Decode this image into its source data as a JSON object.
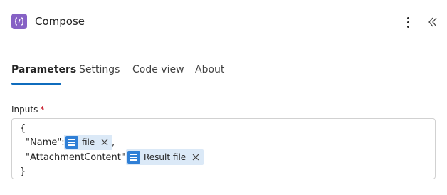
{
  "header": {
    "title": "Compose",
    "app_icon": "compose-icon",
    "accent": "#8661c5"
  },
  "tabs": [
    {
      "label": "Parameters",
      "active": true
    },
    {
      "label": "Settings",
      "active": false
    },
    {
      "label": "Code view",
      "active": false
    },
    {
      "label": "About",
      "active": false
    }
  ],
  "inputs": {
    "label": "Inputs",
    "required_mark": "*",
    "lines": {
      "open": "{",
      "name_key": "\"Name\":",
      "comma": ",",
      "attachment_key": "\"AttachmentContent\":",
      "close": "}"
    },
    "tokens": [
      {
        "label": "file",
        "icon": "dynamic-content-icon"
      },
      {
        "label": "Result file",
        "icon": "dynamic-content-icon"
      }
    ]
  },
  "colors": {
    "tab_underline": "#0f6cbd",
    "token_bg": "#dbe9f7",
    "token_icon": "#2f7fd6",
    "required": "#c50f1f"
  }
}
